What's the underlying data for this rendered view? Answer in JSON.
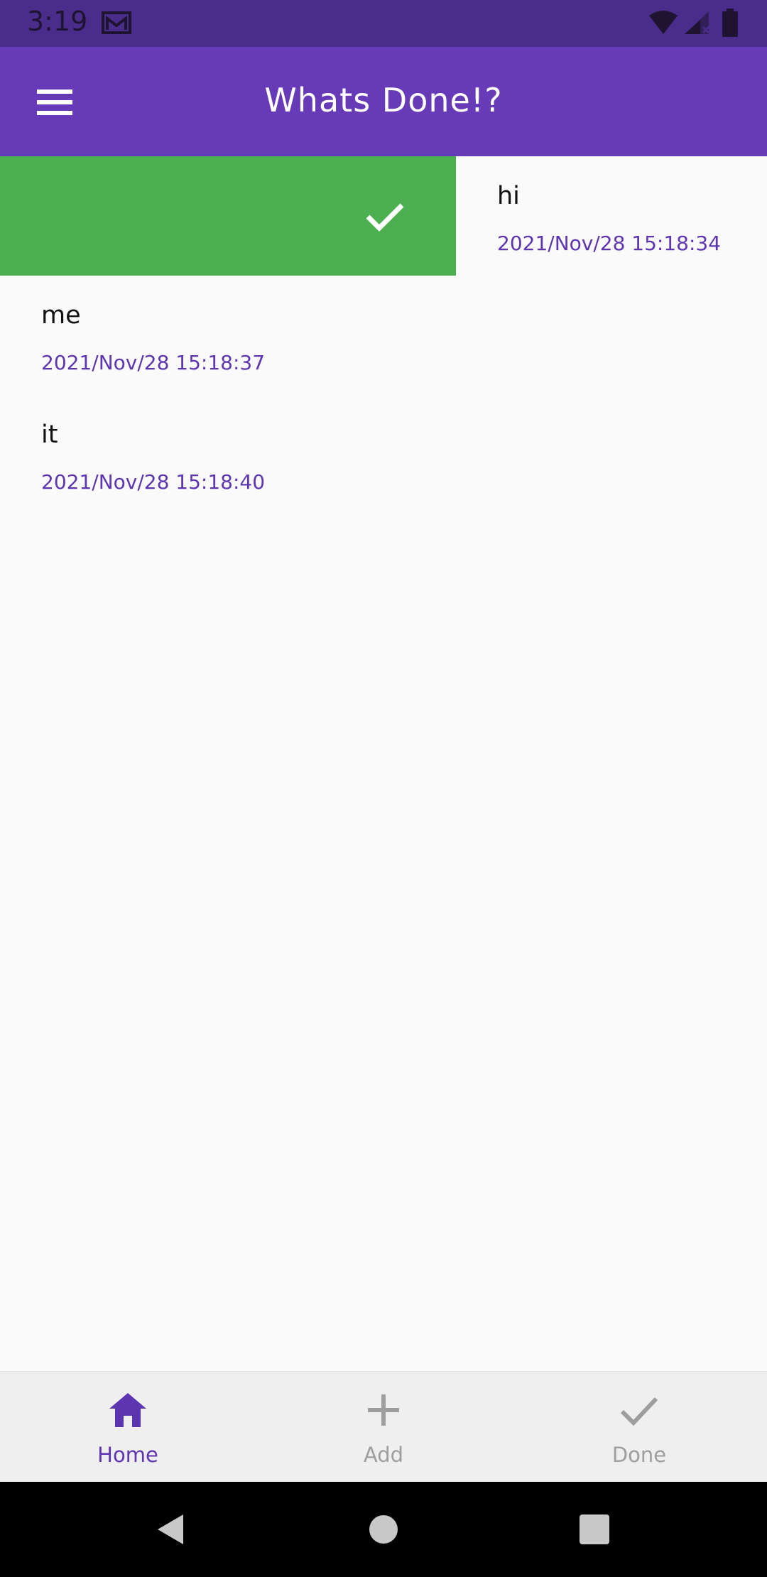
{
  "status_bar": {
    "time": "3:19",
    "background": "#4a2d8a"
  },
  "app_bar": {
    "title": "Whats Done!?",
    "background": "#673ab7"
  },
  "swipe_action": {
    "background": "#4caf50",
    "icon": "check-icon"
  },
  "tasks": [
    {
      "title": "hi",
      "date": "2021/Nov/28 15:18:34"
    },
    {
      "title": "me",
      "date": "2021/Nov/28 15:18:37"
    },
    {
      "title": "it",
      "date": "2021/Nov/28 15:18:40"
    }
  ],
  "bottom_nav": {
    "items": [
      {
        "label": "Home",
        "icon": "home-icon",
        "active": true
      },
      {
        "label": "Add",
        "icon": "plus-icon",
        "active": false
      },
      {
        "label": "Done",
        "icon": "check-icon",
        "active": false
      }
    ],
    "active_color": "#5e35b1",
    "inactive_color": "#9e9e9e"
  },
  "system_nav": {
    "buttons": [
      "back-icon",
      "home-circle-icon",
      "recents-icon"
    ]
  }
}
